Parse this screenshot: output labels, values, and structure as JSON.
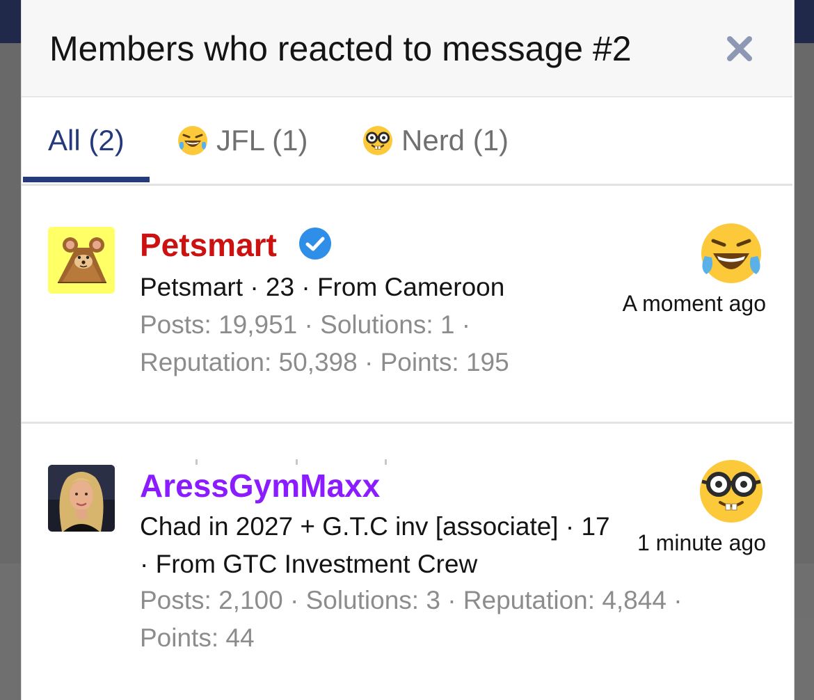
{
  "modal": {
    "title": "Members who reacted to message #2",
    "close_icon": "close-icon"
  },
  "tabs": [
    {
      "label": "All (2)",
      "active": true
    },
    {
      "label": "JFL (1)",
      "icon": "laughing-crying-emoji-icon"
    },
    {
      "label": "Nerd (1)",
      "icon": "nerd-emoji-icon"
    }
  ],
  "members": [
    {
      "username": "Petsmart",
      "username_color": "#cc1111",
      "verified": true,
      "user_info": "Petsmart · 23 · From Cameroon",
      "stats": "Posts: 19,951 · Solutions: 1 · Reputation: 50,398 · Points: 195",
      "reaction_icon": "laughing-crying-emoji-icon",
      "time": "A moment ago",
      "avatar": "cartoon-mouse-avatar"
    },
    {
      "username": "AressGymMaxx",
      "username_color": "#8a1cff",
      "verified": false,
      "user_info": "Chad in 2027 + G.T.C inv [associate] · 17 · From GTC Investment Crew",
      "stats": "Posts: 2,100 · Solutions: 3 · Reputation: 4,844 · Points: 44",
      "reaction_icon": "nerd-emoji-icon",
      "time": "1 minute ago",
      "avatar": "blonde-woman-photo-avatar"
    }
  ],
  "colors": {
    "accent": "#253a7a",
    "header_bg": "#f7f7f7",
    "stat_text": "#8c8c8c"
  }
}
